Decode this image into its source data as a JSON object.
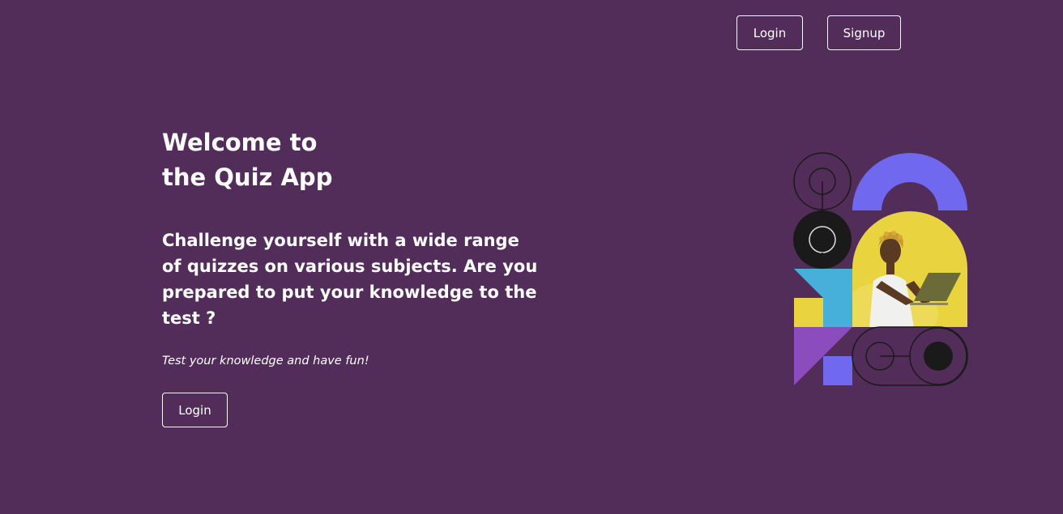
{
  "nav": {
    "login_label": "Login",
    "signup_label": "Signup"
  },
  "hero": {
    "title_line1": "Welcome to",
    "title_line2": "the Quiz App",
    "description": "Challenge yourself with a wide range of quizzes on various subjects. Are you prepared to put your knowledge to the test ?",
    "tagline": "Test your knowledge and have fun!",
    "cta_label": "Login"
  },
  "colors": {
    "background": "#532d5a",
    "accent_purple": "#7068ef",
    "accent_yellow": "#e9d33e",
    "accent_blue": "#46b0db",
    "accent_violet": "#8b4dbd",
    "dark": "#1a1a1a"
  }
}
